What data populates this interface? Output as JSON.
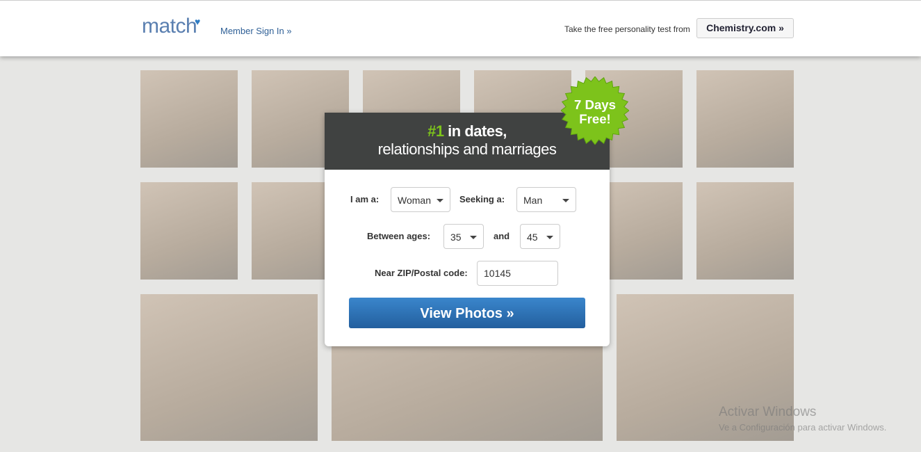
{
  "header": {
    "logo": "match",
    "member_sign_in": "Member Sign In »",
    "promo_text": "Take the free personality test from",
    "chemistry_button": "Chemistry.com »"
  },
  "badge": {
    "line1": "7 Days",
    "line2": "Free!",
    "color": "#7dc31b"
  },
  "panel": {
    "headline_accent": "#1",
    "headline_rest": " in dates,",
    "subheadline": "relationships and marriages",
    "i_am_label": "I am a:",
    "i_am_value": "Woman",
    "seeking_label": "Seeking a:",
    "seeking_value": "Man",
    "ages_label": "Between ages:",
    "age_min": "35",
    "and_label": "and",
    "age_max": "45",
    "zip_label": "Near ZIP/Postal code:",
    "zip_value": "10145",
    "submit": "View Photos »"
  },
  "watermark": {
    "line1": "Activar Windows",
    "line2": "Ve a Configuración para activar Windows."
  }
}
